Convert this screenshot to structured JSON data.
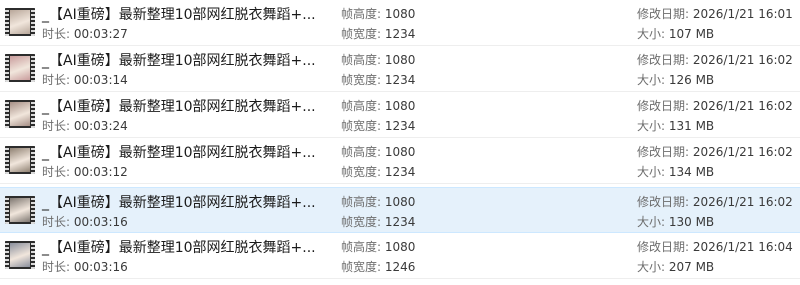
{
  "labels": {
    "duration": "时长: ",
    "frame_height": "帧高度: ",
    "frame_width": "帧宽度: ",
    "modified": "修改日期: ",
    "size": "大小: "
  },
  "files": [
    {
      "title": "_【AI重磅】最新整理10部网红脱衣舞蹈+...",
      "duration": "00:03:27",
      "frame_height": "1080",
      "frame_width": "1234",
      "modified": "2026/1/21 16:01",
      "size": "107 MB",
      "thumb_color": "#b8a79a"
    },
    {
      "title": "_【AI重磅】最新整理10部网红脱衣舞蹈+...",
      "duration": "00:03:14",
      "frame_height": "1080",
      "frame_width": "1234",
      "modified": "2026/1/21 16:02",
      "size": "126 MB",
      "thumb_color": "#c99c9c"
    },
    {
      "title": "_【AI重磅】最新整理10部网红脱衣舞蹈+...",
      "duration": "00:03:24",
      "frame_height": "1080",
      "frame_width": "1234",
      "modified": "2026/1/21 16:02",
      "size": "131 MB",
      "thumb_color": "#a68f86"
    },
    {
      "title": "_【AI重磅】最新整理10部网红脱衣舞蹈+...",
      "duration": "00:03:12",
      "frame_height": "1080",
      "frame_width": "1234",
      "modified": "2026/1/21 16:02",
      "size": "134 MB",
      "thumb_color": "#8f8172"
    },
    {
      "title": "_【AI重磅】最新整理10部网红脱衣舞蹈+...",
      "duration": "00:03:16",
      "frame_height": "1080",
      "frame_width": "1234",
      "modified": "2026/1/21 16:02",
      "size": "130 MB",
      "thumb_color": "#7d7670",
      "selected": true
    },
    {
      "title": "_【AI重磅】最新整理10部网红脱衣舞蹈+...",
      "duration": "00:03:16",
      "frame_height": "1080",
      "frame_width": "1246",
      "modified": "2026/1/21 16:04",
      "size": "207 MB",
      "thumb_color": "#8a8f9c"
    }
  ]
}
